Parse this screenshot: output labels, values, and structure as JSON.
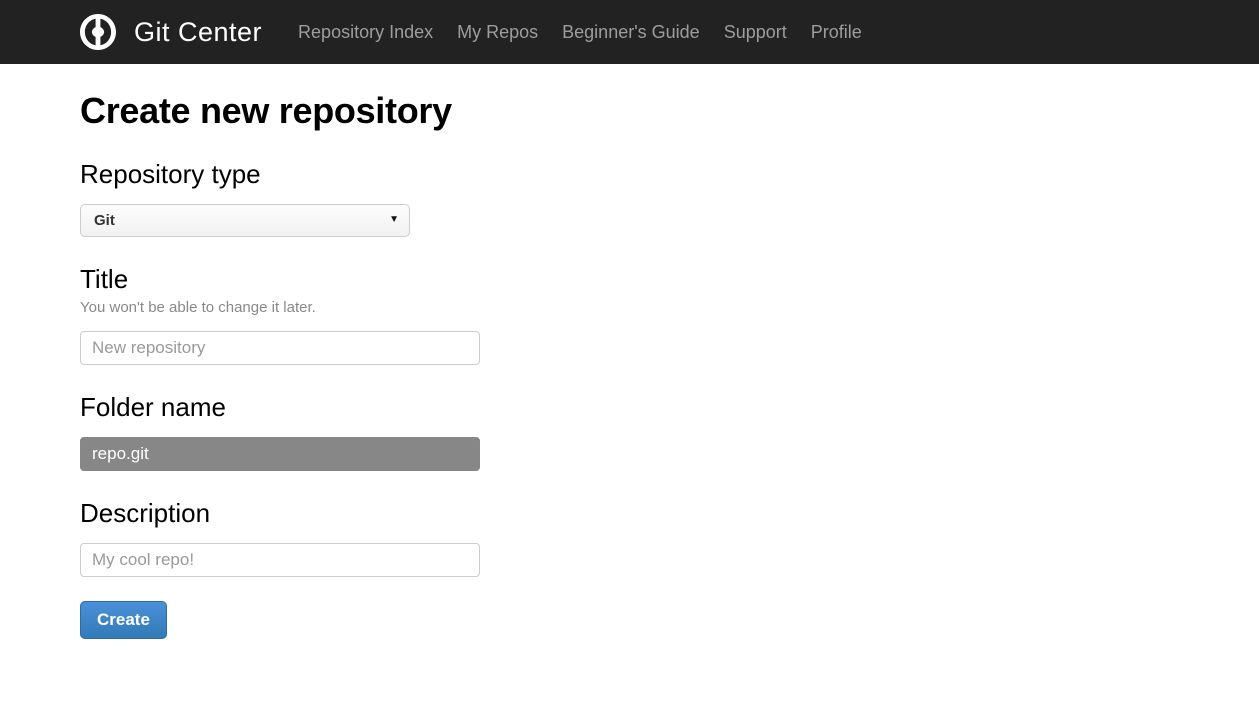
{
  "navbar": {
    "logo_icon": "git-center-logo-icon",
    "brand": "Git Center",
    "links": [
      {
        "label": "Repository Index"
      },
      {
        "label": "My Repos"
      },
      {
        "label": "Beginner's Guide"
      },
      {
        "label": "Support"
      },
      {
        "label": "Profile"
      }
    ],
    "background_color": "#222222",
    "link_color": "#9d9d9d",
    "brand_color": "#ffffff"
  },
  "main": {
    "page_title": "Create new repository",
    "fields": {
      "repository_type": {
        "label": "Repository type",
        "selected": "Git",
        "options": [
          "Git"
        ],
        "arrow_icon": "▼"
      },
      "title": {
        "label": "Title",
        "help": "You won't be able to change it later.",
        "placeholder": "New repository",
        "value": ""
      },
      "folder_name": {
        "label": "Folder name",
        "placeholder": "repo.git",
        "value": "",
        "background_color": "#878787",
        "text_color": "#ffffff"
      },
      "description": {
        "label": "Description",
        "placeholder": "My cool repo!",
        "value": ""
      }
    },
    "submit": {
      "label": "Create",
      "color": "#337ab7"
    }
  }
}
